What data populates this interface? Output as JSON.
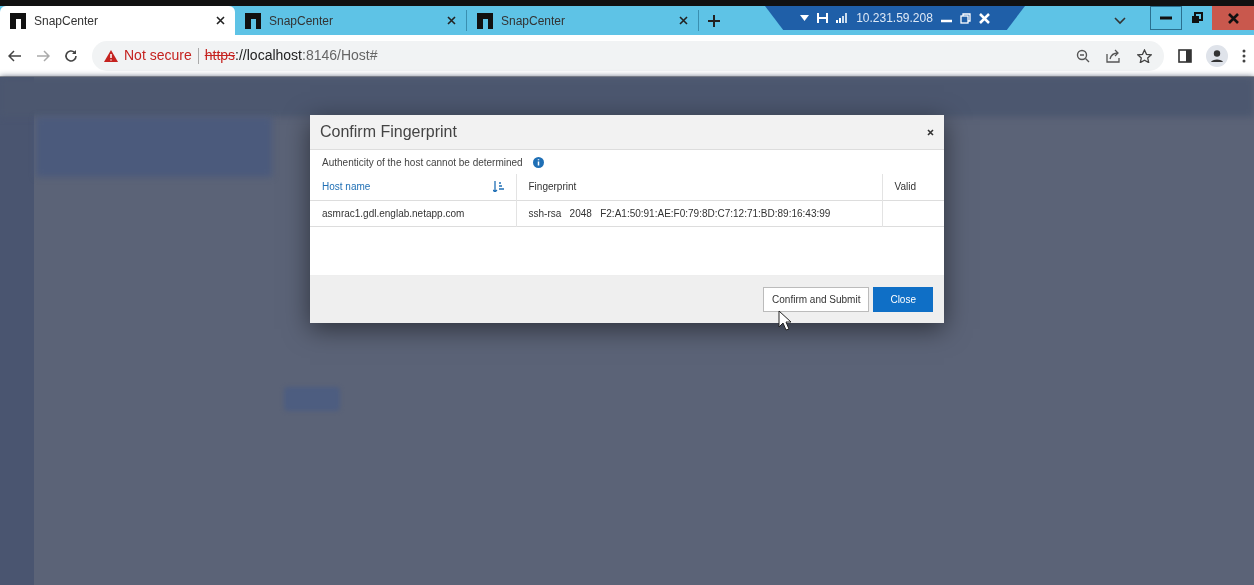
{
  "browser": {
    "tabs": [
      {
        "title": "SnapCenter",
        "selected": true
      },
      {
        "title": "SnapCenter",
        "selected": false
      },
      {
        "title": "SnapCenter",
        "selected": false
      }
    ],
    "address_bar": {
      "security": "Not secure",
      "scheme": "https",
      "host": "://localhost",
      "path": ":8146/Host#"
    }
  },
  "remote_bar": {
    "address": "10.231.59.208"
  },
  "dialog": {
    "title": "Confirm Fingerprint",
    "message": "Authenticity of the host cannot be determined",
    "table": {
      "columns": [
        {
          "label": "Host name",
          "sorted": true
        },
        {
          "label": "Fingerprint",
          "sorted": false
        },
        {
          "label": "Valid",
          "sorted": false
        }
      ],
      "rows": [
        {
          "host": "asmrac1.gdl.englab.netapp.com",
          "type": "ssh-rsa",
          "bits": "2048",
          "fingerprint": "F2:A1:50:91:AE:F0:79:8D:C7:12:71:BD:89:16:43:99"
        }
      ]
    },
    "buttons": [
      {
        "label": "Confirm and Submit",
        "kind": "secondary"
      },
      {
        "label": "Close",
        "kind": "primary"
      }
    ]
  }
}
